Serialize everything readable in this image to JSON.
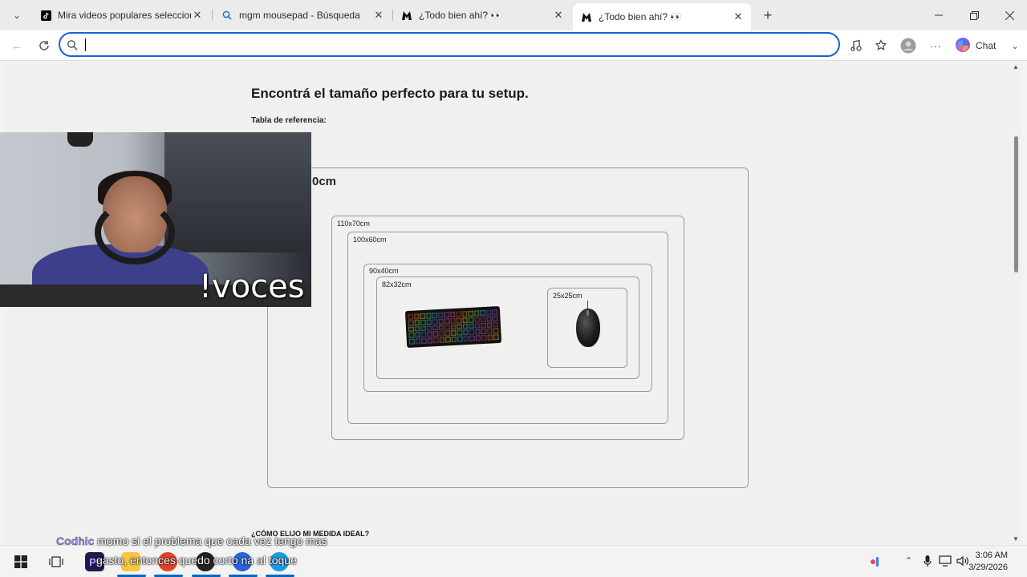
{
  "browser": {
    "tabs": [
      {
        "title": "Mira videos populares seleccionad",
        "icon": "tiktok-icon",
        "active": false
      },
      {
        "title": "mgm mousepad - Búsqueda",
        "icon": "search-icon",
        "active": false
      },
      {
        "title": "¿Todo bien ahí? 👀",
        "icon": "mgm-logo-icon",
        "active": false
      },
      {
        "title": "¿Todo bien ahí? 👀",
        "icon": "mgm-logo-icon",
        "active": true
      }
    ],
    "address_value": "",
    "chat_label": "Chat"
  },
  "page": {
    "heading": "Encontrá el tamaño perfecto para tu setup.",
    "reference_label": "Tabla de referencia:",
    "sizes": {
      "outer_partial": "0cm",
      "s110x70": "110x70cm",
      "s100x60": "100x60cm",
      "s90x40": "90x40cm",
      "s82x32": "82x32cm",
      "s25x25": "25x25cm"
    },
    "ideal_heading": "¿CÓMO ELIJO MI MEDIDA IDEAL?"
  },
  "stream": {
    "webcam_overlay": "!voces",
    "chat_user": "Codhic",
    "chat_message": "momo si el problema que cada vez tengo mas",
    "chat_message_2": "gasto, entonces quedo corto na al toque"
  },
  "taskbar": {
    "time": "3:06 AM",
    "date": "3/29/2026"
  },
  "colors": {
    "accent": "#1a62d6",
    "box_border": "#9a9a9a",
    "chat_user": "#a58be8"
  }
}
